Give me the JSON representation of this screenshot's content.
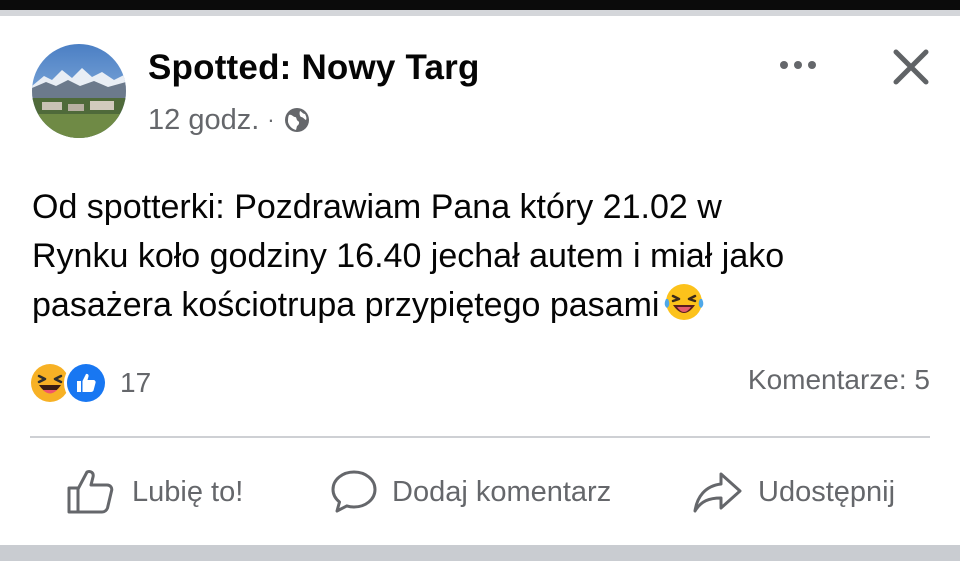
{
  "post": {
    "page_name": "Spotted: Nowy Targ",
    "time": "12 godz.",
    "separator": "·",
    "text_lines": [
      "Od spotterki: Pozdrawiam Pana który 21.02 w",
      "Rynku koło godziny 16.40 jechał autem i miał jako",
      "pasażera kościotrupa przypiętego pasami"
    ],
    "inline_emoji": "laughing-tears-emoji"
  },
  "reactions": {
    "types": [
      "haha",
      "like"
    ],
    "count": "17"
  },
  "comments": {
    "label": "Komentarze: 5"
  },
  "actions": {
    "like_label": "Lubię to!",
    "comment_label": "Dodaj komentarz",
    "share_label": "Udostępnij"
  },
  "icons": {
    "header_more": "more-horizontal-icon",
    "header_close": "close-icon",
    "privacy": "globe-icon",
    "like": "thumbs-up-icon",
    "comment": "speech-bubble-icon",
    "share": "share-arrow-icon"
  },
  "colors": {
    "like_blue": "#1877f2",
    "haha_yellow": "#f7b125",
    "secondary_text": "#65676b"
  }
}
